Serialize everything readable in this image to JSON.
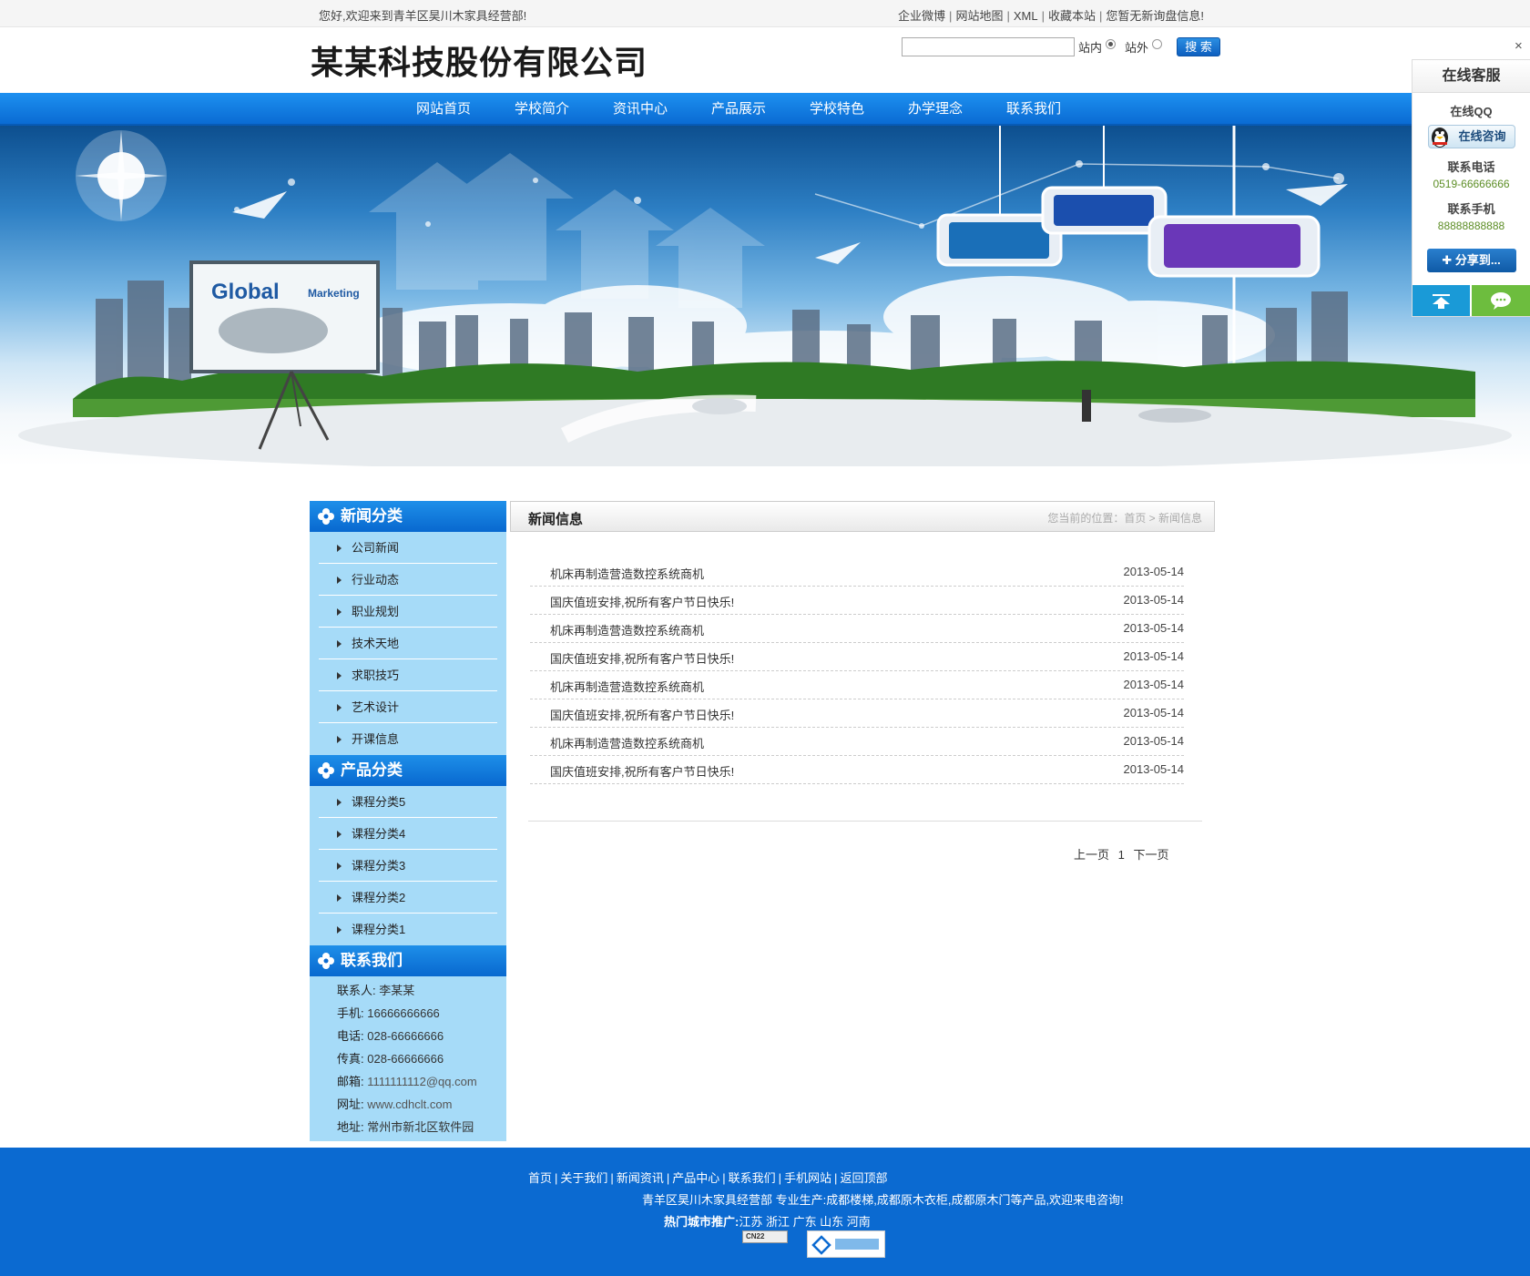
{
  "topbar": {
    "welcome": "您好,欢迎来到青羊区昊川木家具经营部!",
    "links": [
      "企业微博",
      "网站地图",
      "XML",
      "收藏本站",
      "您暂无新询盘信息!"
    ]
  },
  "header": {
    "logo_text": "某某科技股份有限公司",
    "search": {
      "value": "",
      "option_in": "站内",
      "option_out": "站外",
      "button": "搜 索"
    }
  },
  "nav": [
    "网站首页",
    "学校简介",
    "资讯中心",
    "产品展示",
    "学校特色",
    "办学理念",
    "联系我们"
  ],
  "banner": {
    "board_text_1": "Global",
    "board_text_2": "Marketing"
  },
  "sidebar": {
    "news_category": {
      "title": "新闻分类",
      "items": [
        "公司新闻",
        "行业动态",
        "职业规划",
        "技术天地",
        "求职技巧",
        "艺术设计",
        "开课信息"
      ]
    },
    "product_category": {
      "title": "产品分类",
      "items": [
        "课程分类5",
        "课程分类4",
        "课程分类3",
        "课程分类2",
        "课程分类1"
      ]
    },
    "contact": {
      "title": "联系我们",
      "lines": [
        {
          "label": "联系人:",
          "value": "李某某"
        },
        {
          "label": "手机:",
          "value": "16666666666"
        },
        {
          "label": "电话:",
          "value": "028-66666666"
        },
        {
          "label": "传真:",
          "value": "028-66666666"
        },
        {
          "label": "邮箱:",
          "value": "1111111112@qq.com"
        },
        {
          "label": "网址:",
          "value": "www.cdhclt.com"
        },
        {
          "label": "地址:",
          "value": "常州市新北区软件园"
        }
      ]
    }
  },
  "main": {
    "title": "新闻信息",
    "breadcrumb": "您当前的位置：首页 > 新闻信息",
    "news": [
      {
        "title": "机床再制造营造数控系统商机",
        "date": "2013-05-14"
      },
      {
        "title": "国庆值班安排,祝所有客户节日快乐!",
        "date": "2013-05-14"
      },
      {
        "title": "机床再制造营造数控系统商机",
        "date": "2013-05-14"
      },
      {
        "title": "国庆值班安排,祝所有客户节日快乐!",
        "date": "2013-05-14"
      },
      {
        "title": "机床再制造营造数控系统商机",
        "date": "2013-05-14"
      },
      {
        "title": "国庆值班安排,祝所有客户节日快乐!",
        "date": "2013-05-14"
      },
      {
        "title": "机床再制造营造数控系统商机",
        "date": "2013-05-14"
      },
      {
        "title": "国庆值班安排,祝所有客户节日快乐!",
        "date": "2013-05-14"
      }
    ],
    "pager": {
      "prev": "上一页",
      "page": "1",
      "next": "下一页"
    }
  },
  "footer": {
    "links": [
      "首页",
      "关于我们",
      "新闻资讯",
      "产品中心",
      "联系我们",
      "手机网站",
      "返回顶部"
    ],
    "desc": "青羊区昊川木家具经营部 专业生产:成都楼梯,成都原木衣柜,成都原木门等产品,欢迎来电咨询!",
    "hot_label": "热门城市推广:",
    "hot_cities": "江苏 浙江 广东 山东 河南",
    "badge_text": "CN22"
  },
  "service": {
    "close": "×",
    "title": "在线客服",
    "qq_label": "在线QQ",
    "qq_button": "在线咨询",
    "phone_label": "联系电话",
    "phone": "0519-66666666",
    "mobile_label": "联系手机",
    "mobile": "88888888888",
    "share": "分享到..."
  },
  "colors": {
    "brand_blue": "#0b6ad1",
    "sidebar_bg": "#a6dbf8",
    "green": "#6dbd3e"
  }
}
